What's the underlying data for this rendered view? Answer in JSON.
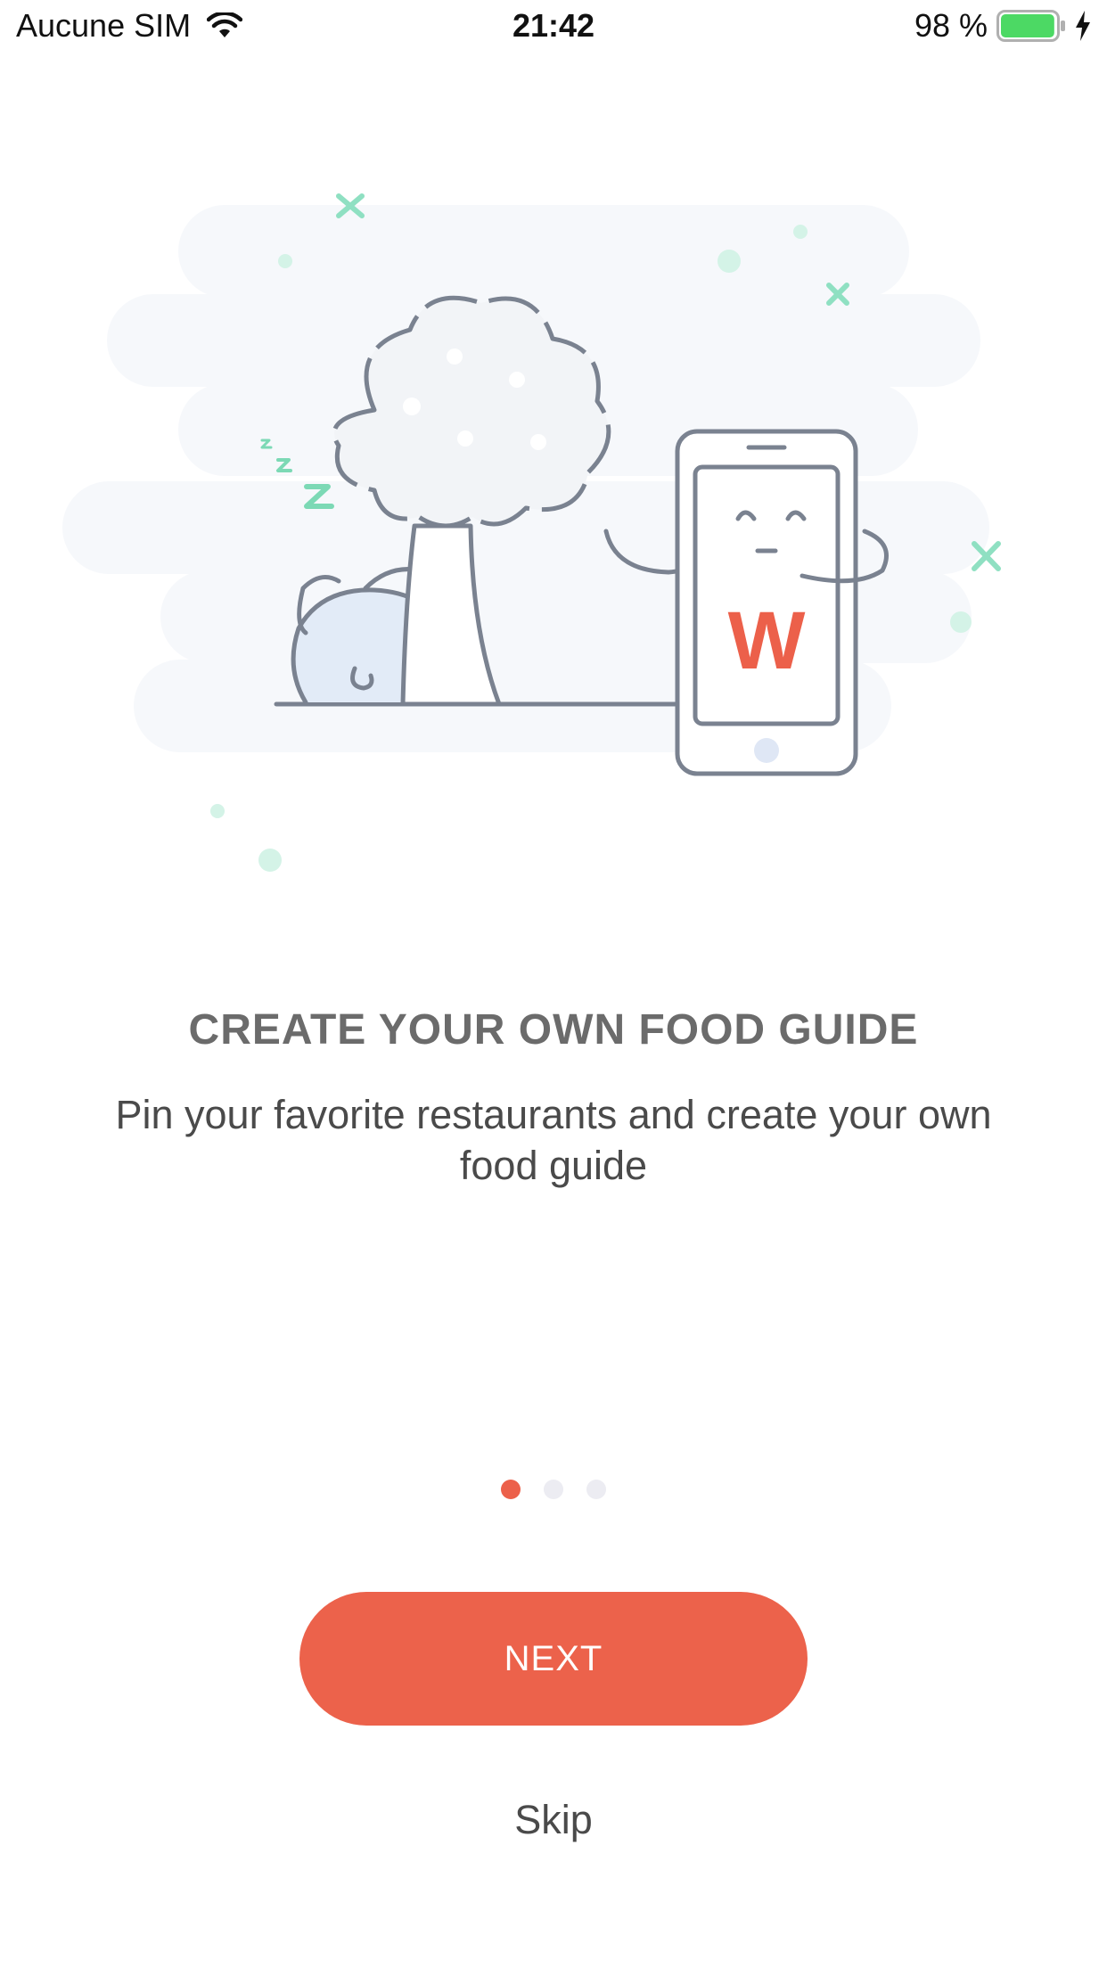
{
  "status_bar": {
    "carrier": "Aucune SIM",
    "time": "21:42",
    "battery_percent": "98 %",
    "battery_level": 0.98,
    "battery_color": "#4cd964",
    "icons": [
      "wifi-icon",
      "battery-icon",
      "charging-icon"
    ]
  },
  "illustration": {
    "logo_letter": "W",
    "logo_color": "#ec604a",
    "icons": [
      "tree",
      "sleeping-cat",
      "smiling-phone"
    ]
  },
  "onboarding": {
    "title": "CREATE YOUR OWN FOOD GUIDE",
    "description": "Pin your favorite restaurants and create your own food guide",
    "page_index": 1,
    "page_count": 3
  },
  "actions": {
    "next_label": "NEXT",
    "skip_label": "Skip",
    "accent_color": "#ec624b"
  }
}
